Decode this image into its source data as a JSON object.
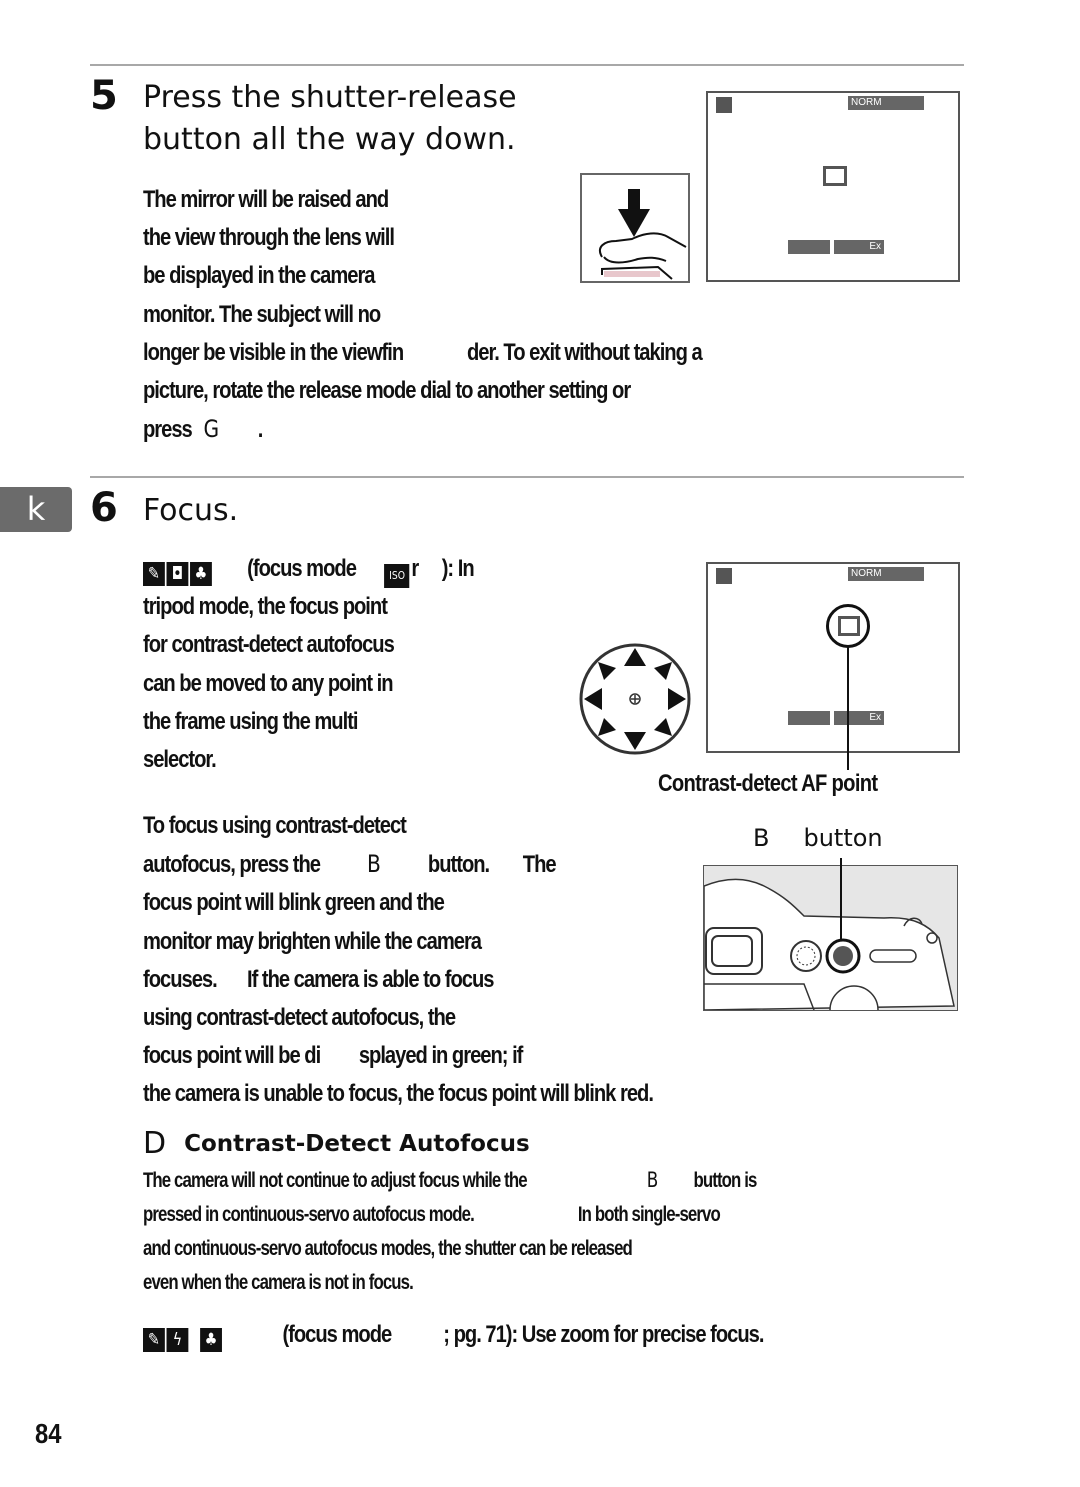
{
  "page": {
    "number": "84",
    "side_tab": "k"
  },
  "step5": {
    "number": "5",
    "title_lines": [
      "Press the shutter-release",
      "button all the way down."
    ],
    "body_lines": [
      "The mirror will be raised and",
      "the view through the lens will",
      "be displayed in the camera",
      "monitor.  The subject will no"
    ],
    "body_wide_lines": [
      {
        "before": "longer be visible in the viewfin",
        "after": "der.  To exit without taking a"
      },
      {
        "before": "picture, rotate the release mode dial to another setting or",
        "after": ""
      }
    ],
    "press_line": {
      "label": "press",
      "key_symbol": "G",
      "end": "."
    },
    "illustration": {
      "shutter_icon": "shutter-press-icon",
      "monitor": {
        "top_right_badge": "NORM",
        "bottom_badge": "Ex"
      }
    }
  },
  "step6": {
    "number": "6",
    "title": "Focus.",
    "mode_icons": [
      "pencil-icon",
      "camera-flash-icon",
      "plant-icon"
    ],
    "mode_line": {
      "text_a": "(focus mode",
      "iso_icon": "ISO",
      "text_b": "r",
      "text_c": "): In"
    },
    "body_lines": [
      "tripod mode, the focus point",
      "for contrast-detect autofocus",
      "can be moved to any point in",
      "the frame using the multi",
      "selector."
    ],
    "af_point_caption": "Contrast-detect AF point",
    "monitor": {
      "top_right_badge": "NORM",
      "bottom_badge": "Ex"
    },
    "button_caption": {
      "key_symbol": "B",
      "label": "button"
    },
    "focus_lines": [
      {
        "text": "To focus using contrast-detect"
      },
      {
        "text": "autofocus, press the",
        "key": "B",
        "after": "button.",
        "tail": "The"
      },
      {
        "text": "focus point will blink green and the"
      },
      {
        "text": "monitor may brighten while the camera"
      },
      {
        "text": "focuses.",
        "tail": "If the camera is able to focus"
      },
      {
        "text": "using contrast-detect autofocus, the"
      },
      {
        "text": "focus point will be di",
        "tail": "splayed in green; if"
      },
      {
        "text": "the camera is unable to focus, the focus point will blink red."
      }
    ]
  },
  "note": {
    "icon_symbol": "D",
    "title": "Contrast-Detect Autofocus",
    "lines": [
      {
        "text": "The camera will not continue to adjust focus while the",
        "key": "B",
        "tail": "button is"
      },
      {
        "text": "pressed in continuous-servo autofocus mode.",
        "tail": "In both single-servo"
      },
      {
        "text": "and continuous-servo autofocus modes, the shutter can be released"
      },
      {
        "text": "even when the camera is not in focus."
      }
    ]
  },
  "final_line": {
    "icons": [
      "portrait-icon",
      "flash-off-icon",
      "plant-icon"
    ],
    "text_a": "(focus mode",
    "text_b": "; pg. 71): Use zoom for precise focus."
  }
}
